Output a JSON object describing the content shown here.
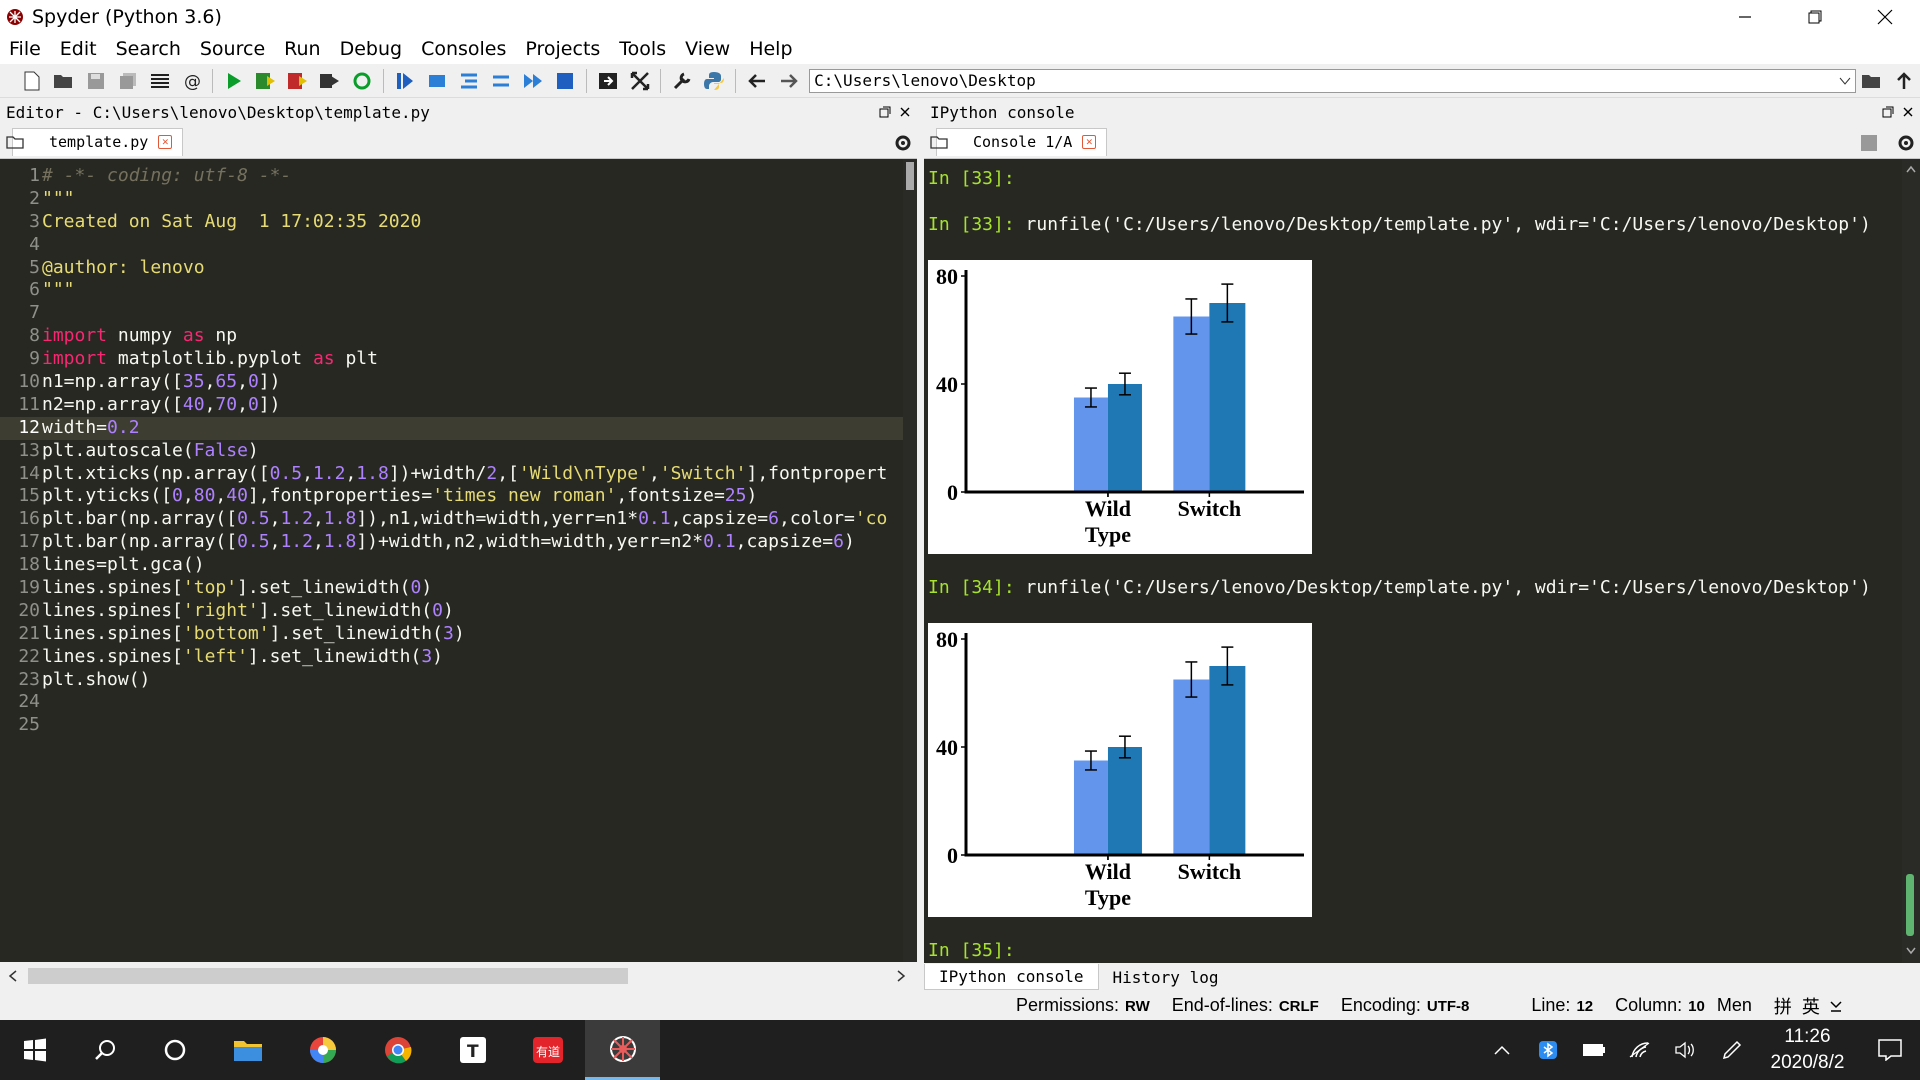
{
  "window": {
    "title": "Spyder (Python 3.6)"
  },
  "menu": [
    "File",
    "Edit",
    "Search",
    "Source",
    "Run",
    "Debug",
    "Consoles",
    "Projects",
    "Tools",
    "View",
    "Help"
  ],
  "toolbar": {
    "path": "C:\\Users\\lenovo\\Desktop"
  },
  "editor": {
    "header": "Editor - C:\\Users\\lenovo\\Desktop\\template.py",
    "tab": "template.py",
    "current_line": 12
  },
  "console": {
    "header": "IPython console",
    "tab": "Console 1/A",
    "prompt33a": "In [33]:",
    "prompt33b": "In [33]:",
    "run33": " runfile('C:/Users/lenovo/Desktop/template.py', wdir='C:/Users/lenovo/Desktop')",
    "prompt34": "In [34]:",
    "run34": " runfile('C:/Users/lenovo/Desktop/template.py', wdir='C:/Users/lenovo/Desktop')",
    "prompt35": "In [35]:",
    "bottom_tabs": [
      "IPython console",
      "History log"
    ]
  },
  "status": {
    "permissions_label": "Permissions:",
    "permissions": "RW",
    "eol_label": "End-of-lines:",
    "eol": "CRLF",
    "encoding_label": "Encoding:",
    "encoding": "UTF-8",
    "line_label": "Line:",
    "line": "12",
    "column_label": "Column:",
    "column": "10",
    "mem_label": "Men"
  },
  "taskbar": {
    "time": "11:26",
    "date": "2020/8/2",
    "ime1": "拼",
    "ime2": "英"
  },
  "colors": {
    "accent_blue": "#1f77b4",
    "light_blue": "#6495ed",
    "editor_bg": "#272822"
  },
  "chart_data": [
    {
      "type": "bar",
      "categories": [
        "Wild Type",
        "Switch"
      ],
      "tick_labels": [
        "Wild",
        "Type",
        "Switch"
      ],
      "series": [
        {
          "values": [
            35,
            65
          ],
          "errors": [
            3.5,
            6.5
          ],
          "color": "#6495ed"
        },
        {
          "values": [
            40,
            70
          ],
          "errors": [
            4,
            7
          ],
          "color": "#1f77b4"
        }
      ],
      "yticks": [
        "0",
        "40",
        "80"
      ],
      "ylim": [
        0,
        80
      ]
    },
    {
      "type": "bar",
      "categories": [
        "Wild Type",
        "Switch"
      ],
      "tick_labels": [
        "Wild",
        "Type",
        "Switch"
      ],
      "series": [
        {
          "values": [
            35,
            65
          ],
          "errors": [
            3.5,
            6.5
          ],
          "color": "#6495ed"
        },
        {
          "values": [
            40,
            70
          ],
          "errors": [
            4,
            7
          ],
          "color": "#1f77b4"
        }
      ],
      "yticks": [
        "0",
        "40",
        "80"
      ],
      "ylim": [
        0,
        80
      ]
    }
  ]
}
